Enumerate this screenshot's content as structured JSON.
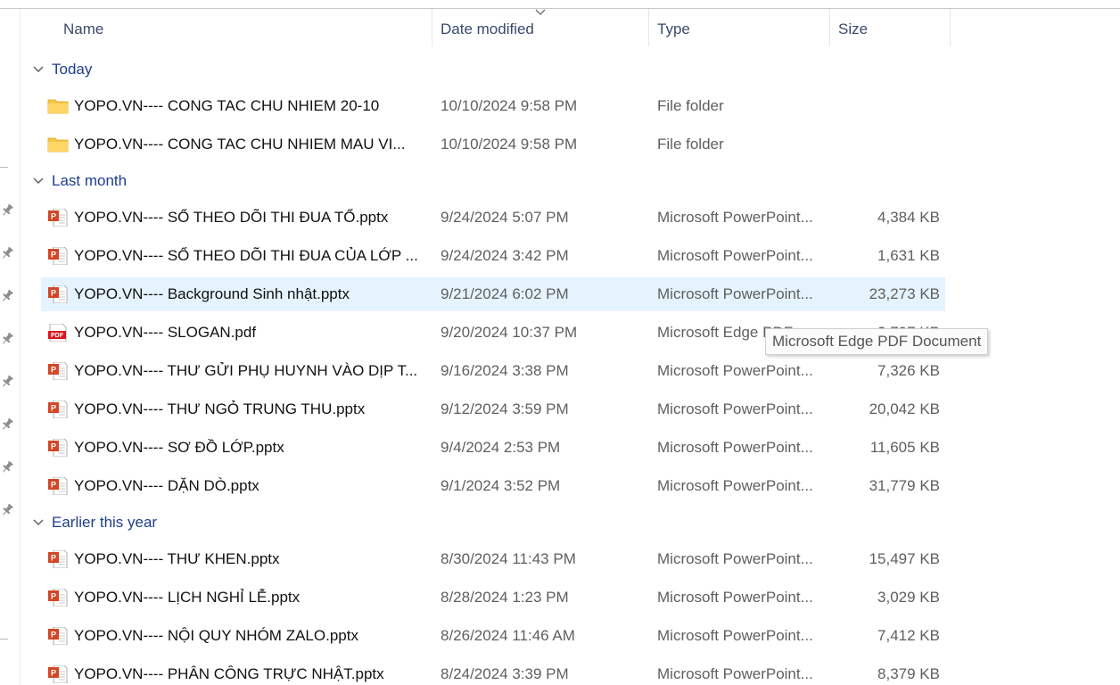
{
  "columns": {
    "name": "Name",
    "date": "Date modified",
    "type": "Type",
    "size": "Size"
  },
  "sort": {
    "column": "date",
    "direction": "descending",
    "indicator": "chevron-down-icon"
  },
  "groups": [
    {
      "label": "Today",
      "expanded": true,
      "items": [
        {
          "icon": "folder-icon",
          "name": "YOPO.VN---- CONG TAC CHU NHIEM 20-10",
          "date": "10/10/2024 9:58 PM",
          "type": "File folder",
          "size": ""
        },
        {
          "icon": "folder-icon",
          "name": "YOPO.VN---- CONG TAC CHU NHIEM  MAU VI...",
          "date": "10/10/2024 9:58 PM",
          "type": "File folder",
          "size": ""
        }
      ]
    },
    {
      "label": "Last month",
      "expanded": true,
      "items": [
        {
          "icon": "pptx-file-icon",
          "name": "YOPO.VN---- SỔ THEO DÕI THI ĐUA TỔ.pptx",
          "date": "9/24/2024 5:07 PM",
          "type": "Microsoft PowerPoint...",
          "size": "4,384 KB"
        },
        {
          "icon": "pptx-file-icon",
          "name": "YOPO.VN---- SỔ THEO DÕI THI ĐUA CỦA LỚP ...",
          "date": "9/24/2024 3:42 PM",
          "type": "Microsoft PowerPoint...",
          "size": "1,631 KB"
        },
        {
          "icon": "pptx-file-icon",
          "name": "YOPO.VN---- Background Sinh nhật.pptx",
          "date": "9/21/2024 6:02 PM",
          "type": "Microsoft PowerPoint...",
          "size": "23,273 KB",
          "selected": true
        },
        {
          "icon": "pdf-file-icon",
          "name": "YOPO.VN---- SLOGAN.pdf",
          "date": "9/20/2024 10:37 PM",
          "type": "Microsoft Edge PDF ...",
          "size": "3,797 KB"
        },
        {
          "icon": "pptx-file-icon",
          "name": "YOPO.VN---- THƯ GỬI PHỤ HUYNH VÀO DỊP T...",
          "date": "9/16/2024 3:38 PM",
          "type": "Microsoft PowerPoint...",
          "size": "7,326 KB"
        },
        {
          "icon": "pptx-file-icon",
          "name": "YOPO.VN---- THƯ NGỎ TRUNG THU.pptx",
          "date": "9/12/2024 3:59 PM",
          "type": "Microsoft PowerPoint...",
          "size": "20,042 KB"
        },
        {
          "icon": "pptx-file-icon",
          "name": "YOPO.VN---- SƠ ĐỒ LỚP.pptx",
          "date": "9/4/2024 2:53 PM",
          "type": "Microsoft PowerPoint...",
          "size": "11,605 KB"
        },
        {
          "icon": "pptx-file-icon",
          "name": "YOPO.VN---- DẶN DÒ.pptx",
          "date": "9/1/2024 3:52 PM",
          "type": "Microsoft PowerPoint...",
          "size": "31,779 KB"
        }
      ]
    },
    {
      "label": "Earlier this year",
      "expanded": true,
      "items": [
        {
          "icon": "pptx-file-icon",
          "name": "YOPO.VN---- THƯ KHEN.pptx",
          "date": "8/30/2024 11:43 PM",
          "type": "Microsoft PowerPoint...",
          "size": "15,497 KB"
        },
        {
          "icon": "pptx-file-icon",
          "name": "YOPO.VN---- LỊCH NGHỈ LỄ.pptx",
          "date": "8/28/2024 1:23 PM",
          "type": "Microsoft PowerPoint...",
          "size": "3,029 KB"
        },
        {
          "icon": "pptx-file-icon",
          "name": "YOPO.VN---- NỘI QUY NHÓM ZALO.pptx",
          "date": "8/26/2024 11:46 AM",
          "type": "Microsoft PowerPoint...",
          "size": "7,412 KB"
        },
        {
          "icon": "pptx-file-icon",
          "name": "YOPO.VN---- PHÂN CÔNG TRỰC NHẬT.pptx",
          "date": "8/24/2024 3:39 PM",
          "type": "Microsoft PowerPoint...",
          "size": "8,379 KB"
        }
      ]
    }
  ],
  "tooltip": {
    "text": "Microsoft Edge PDF Document"
  },
  "quick_access_pins": {
    "icon": "pin-icon",
    "count": 8
  },
  "colors": {
    "group_header": "#1e3e8c",
    "column_header": "#3a4a6b",
    "selected_row": "#e5f3ff",
    "folder": "#f8c64a",
    "pptx": "#d24726",
    "pdf": "#d71920"
  }
}
